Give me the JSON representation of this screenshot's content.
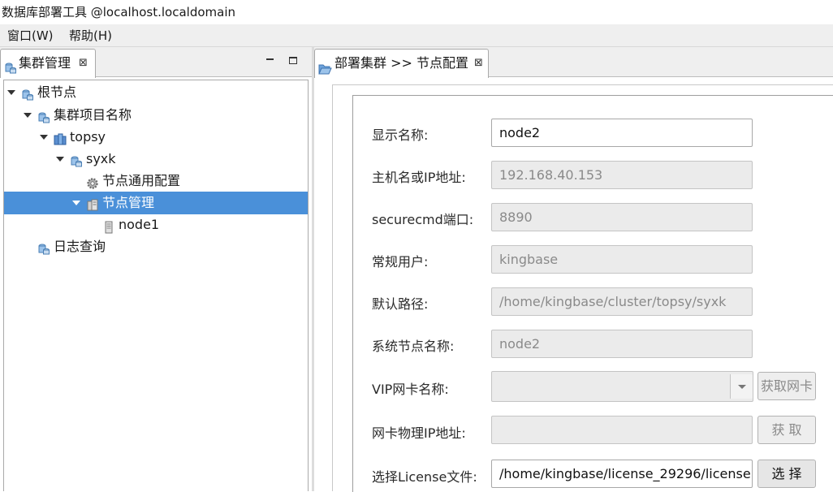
{
  "window": {
    "title": "数据库部署工具 @localhost.localdomain"
  },
  "menu": [
    "窗口(W)",
    "帮助(H)"
  ],
  "left_panel": {
    "tab_label": "集群管理",
    "tab_close": "⊠",
    "tree": [
      {
        "label": "根节点",
        "level": 0,
        "expanded": true,
        "icon": "database-icon"
      },
      {
        "label": "集群项目名称",
        "level": 1,
        "expanded": true,
        "icon": "database-icon"
      },
      {
        "label": "topsy",
        "level": 2,
        "expanded": true,
        "icon": "cluster-icon"
      },
      {
        "label": "syxk",
        "level": 3,
        "expanded": true,
        "icon": "database-icon"
      },
      {
        "label": "节点通用配置",
        "level": 4,
        "expanded": null,
        "icon": "gear-icon"
      },
      {
        "label": "节点管理",
        "level": 4,
        "expanded": true,
        "icon": "server-icon",
        "selected": true
      },
      {
        "label": "node1",
        "level": 5,
        "expanded": null,
        "icon": "node-icon"
      },
      {
        "label": "日志查询",
        "level": 1,
        "expanded": null,
        "icon": "database-icon"
      }
    ]
  },
  "right_panel": {
    "tab_label": "部署集群 >> 节点配置",
    "tab_close": "⊠",
    "form": {
      "display_name": {
        "label": "显示名称:",
        "value": "node2"
      },
      "host": {
        "label": "主机名或IP地址:",
        "value": "192.168.40.153"
      },
      "securecmd_port": {
        "label": "securecmd端口:",
        "value": "8890"
      },
      "user": {
        "label": "常规用户:",
        "value": "kingbase"
      },
      "default_path": {
        "label": "默认路径:",
        "value": "/home/kingbase/cluster/topsy/syxk"
      },
      "system_node_name": {
        "label": "系统节点名称:",
        "value": "node2"
      },
      "vip_nic": {
        "label": "VIP网卡名称:",
        "value": "",
        "button": "获取网卡"
      },
      "nic_ip": {
        "label": "网卡物理IP地址:",
        "value": "",
        "button": "获 取"
      },
      "license": {
        "label": "选择License文件:",
        "value": "/home/kingbase/license_29296/license",
        "button": "选 择"
      }
    }
  },
  "colors": {
    "selection": "#4a90d9",
    "readonly_bg": "#ebebeb",
    "readonly_text": "#8a8a8a"
  }
}
